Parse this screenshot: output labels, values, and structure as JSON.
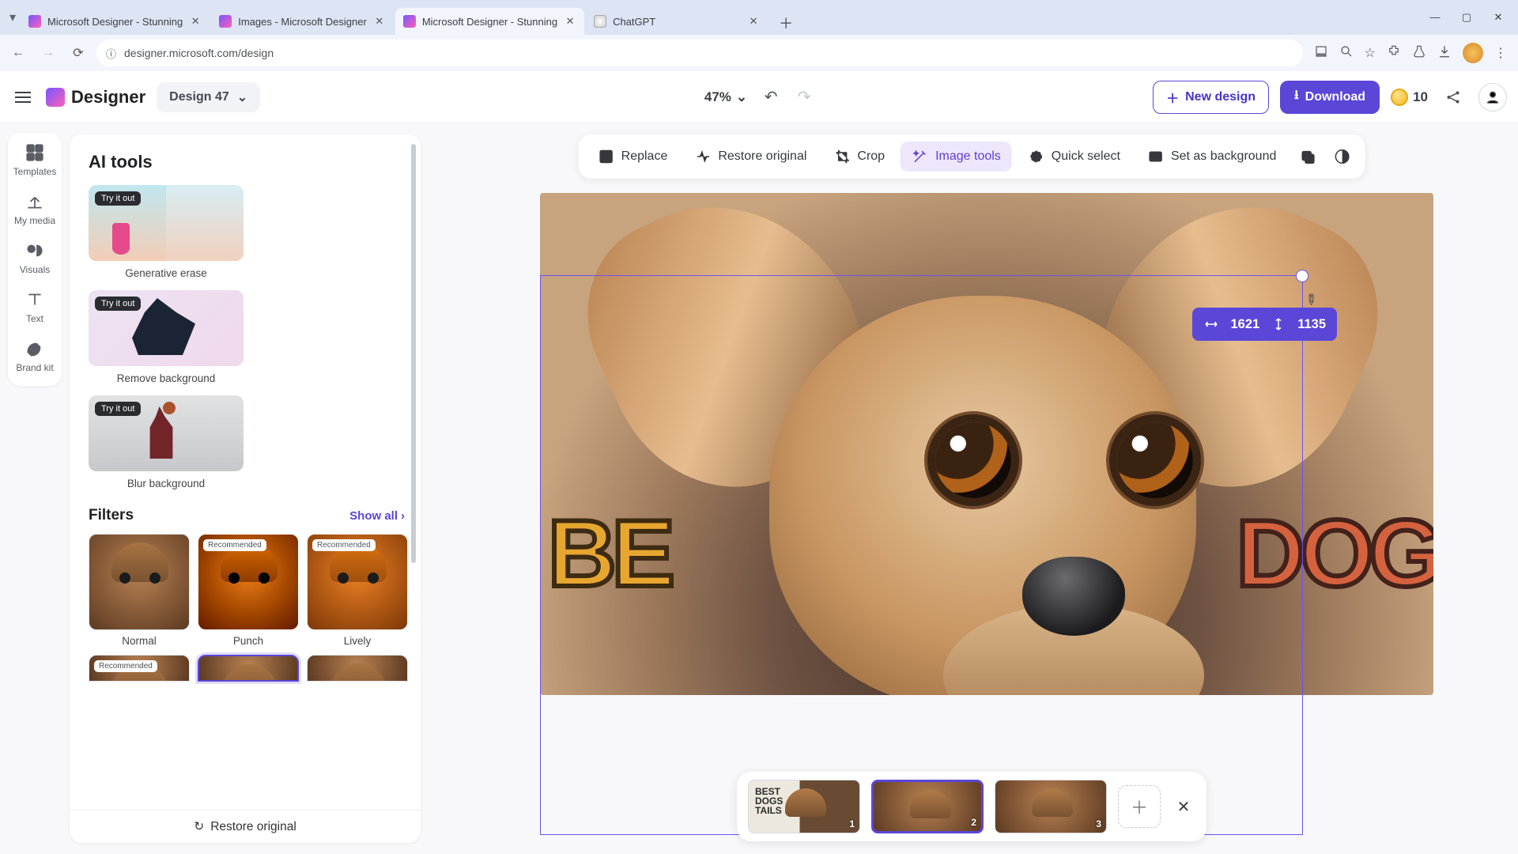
{
  "browser": {
    "tabs": [
      {
        "title": "Microsoft Designer - Stunning",
        "active": false,
        "fav": "designer"
      },
      {
        "title": "Images - Microsoft Designer",
        "active": false,
        "fav": "designer"
      },
      {
        "title": "Microsoft Designer - Stunning",
        "active": true,
        "fav": "designer"
      },
      {
        "title": "ChatGPT",
        "active": false,
        "fav": "chatgpt"
      }
    ],
    "url": "designer.microsoft.com/design"
  },
  "app_bar": {
    "brand": "Designer",
    "design_name": "Design 47",
    "zoom": "47%",
    "new_design": "New design",
    "download": "Download",
    "credits": "10"
  },
  "rail": {
    "items": [
      "Templates",
      "My media",
      "Visuals",
      "Text",
      "Brand kit"
    ]
  },
  "panel": {
    "ai_tools_title": "AI tools",
    "try_badge": "Try it out",
    "ai_cards": {
      "gen_erase": "Generative erase",
      "remove_bg": "Remove background",
      "blur_bg": "Blur background"
    },
    "filters_title": "Filters",
    "show_all": "Show all",
    "recommended": "Recommended",
    "filters": {
      "normal": "Normal",
      "punch": "Punch",
      "lively": "Lively"
    },
    "restore_original": "Restore original"
  },
  "context_bar": {
    "replace": "Replace",
    "restore": "Restore original",
    "crop": "Crop",
    "image_tools": "Image tools",
    "quick_select": "Quick select",
    "set_bg": "Set as background"
  },
  "canvas": {
    "text_left": "BE",
    "text_right": "DOG",
    "dim_w": "1621",
    "dim_h": "1135"
  },
  "pages": {
    "p1": "1",
    "p2": "2",
    "p3": "3"
  }
}
